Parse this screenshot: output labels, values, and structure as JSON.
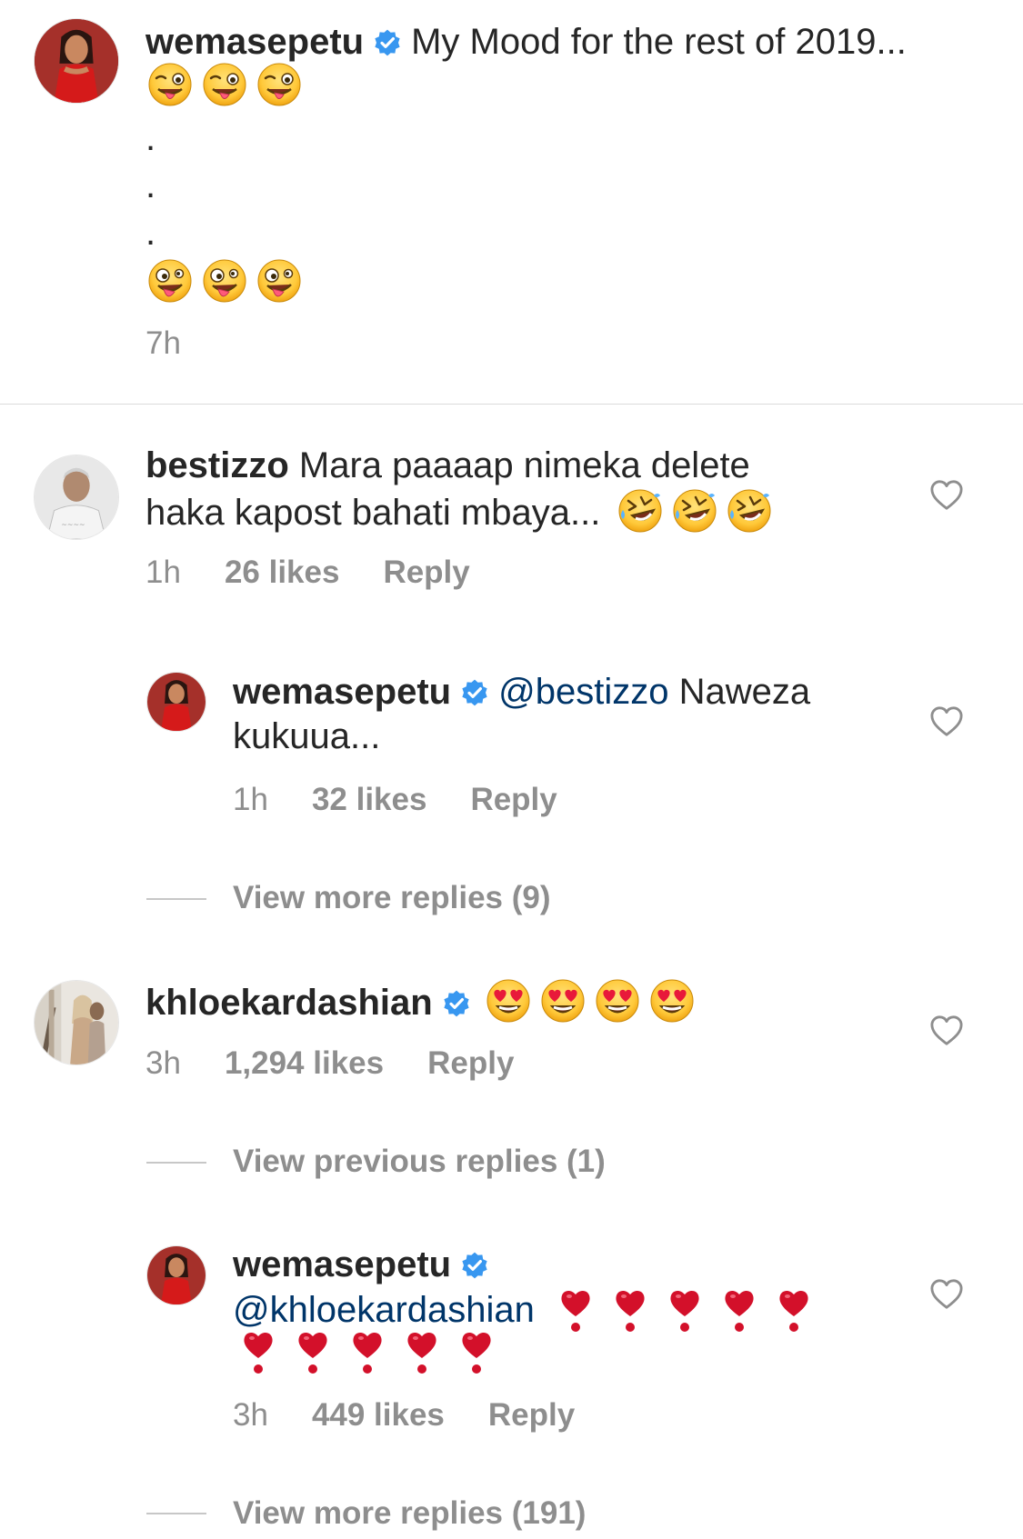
{
  "caption": {
    "username": "wemasepetu",
    "text": "My Mood for the rest of 2019...",
    "dots": [
      ".",
      ".",
      "."
    ],
    "timestamp": "7h"
  },
  "comments": [
    {
      "username": "bestizzo",
      "text_line1": "Mara paaaap nimeka delete",
      "text_line2": "haka kapost bahati mbaya...",
      "time": "1h",
      "likes": "26 likes",
      "reply": "Reply"
    },
    {
      "username": "wemasepetu",
      "mention": "@bestizzo",
      "text_line1": "Naweza",
      "text_line2": "kukuua...",
      "time": "1h",
      "likes": "32 likes",
      "reply": "Reply"
    },
    {
      "view_more": "View more replies (9)"
    },
    {
      "username": "khloekardashian",
      "time": "3h",
      "likes": "1,294 likes",
      "reply": "Reply"
    },
    {
      "view_previous": "View previous replies (1)"
    },
    {
      "username": "wemasepetu",
      "mention": "@khloekardashian",
      "time": "3h",
      "likes": "449 likes",
      "reply": "Reply"
    },
    {
      "view_more": "View more replies (191)"
    }
  ],
  "colors": {
    "verified_badge": "#3897f0",
    "mention": "#003569",
    "meta_gray": "#8e8e8e",
    "heart_red": "#d3102a"
  },
  "icons": {
    "verified": "verified-badge-icon",
    "like": "heart-outline-icon",
    "wink": "winking-tongue-emoji",
    "zany": "zany-face-emoji",
    "rofl": "rolling-laughing-emoji",
    "heart_eyes": "heart-eyes-emoji",
    "heart_exclamation": "heart-exclamation-emoji"
  }
}
